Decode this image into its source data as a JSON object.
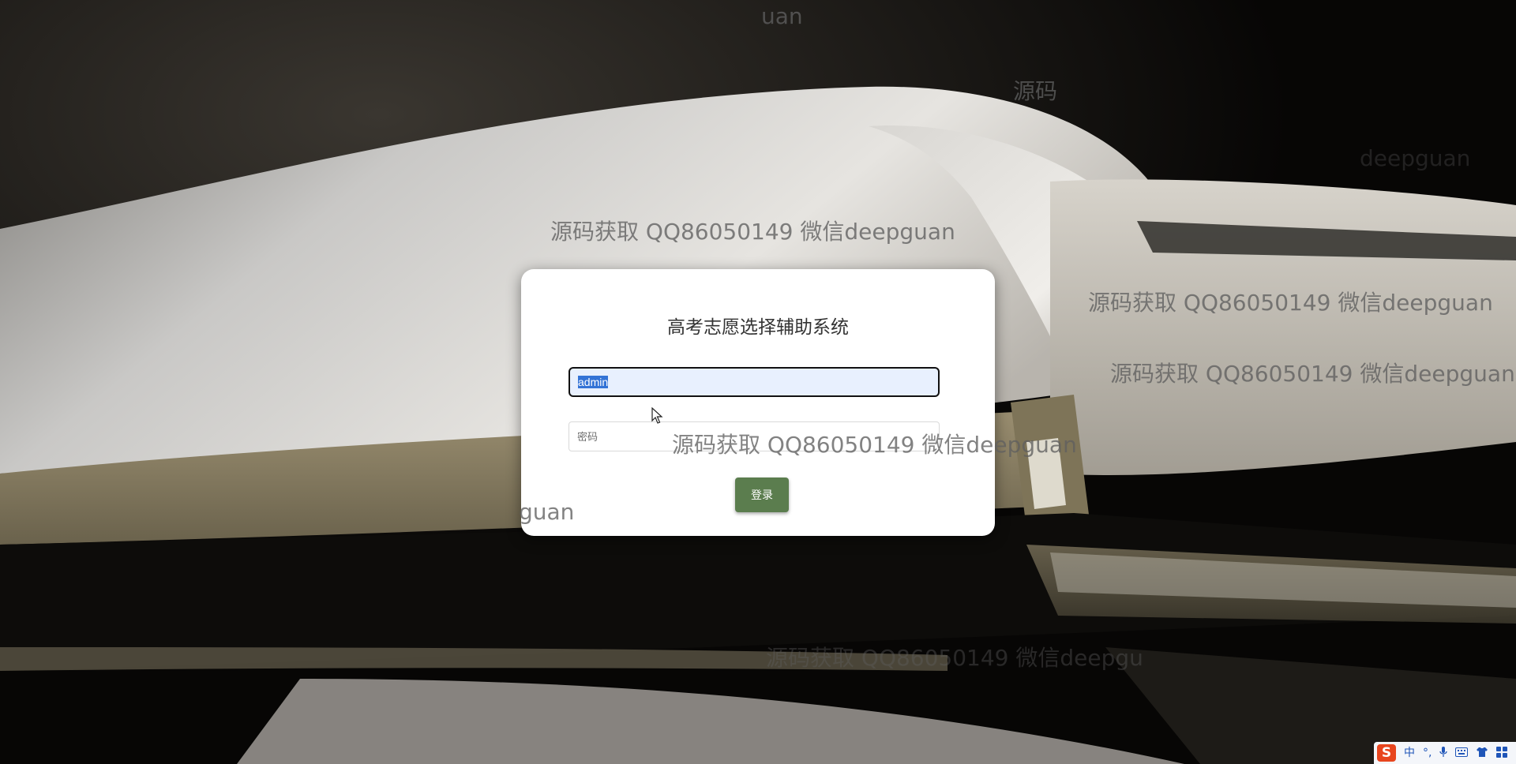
{
  "page": {
    "title": "高考志愿选择辅助系统"
  },
  "login_form": {
    "username_value": "admin",
    "password_placeholder": "密码",
    "submit_label": "登录"
  },
  "watermarks": [
    "源码获取 QQ86050149 微信deepguan",
    "源码获取 QQ86050149 微信deepguan",
    "源码获取 QQ86050149 微信deepguan",
    "源码获取 QQ86050149 微信deepguan",
    "uan",
    "源码",
    "deepguan",
    "guan",
    "源码获取 QQ86050149 微信deepgu"
  ],
  "ime": {
    "logo": "S",
    "mode": "中",
    "punct": "°,",
    "items": [
      "microphone-icon",
      "keyboard-icon",
      "skin-icon",
      "toolbox-icon"
    ]
  },
  "colors": {
    "button_bg": "#5b7d4e",
    "input_focus_bg": "#e8f0fe",
    "selection": "#3373d6"
  }
}
